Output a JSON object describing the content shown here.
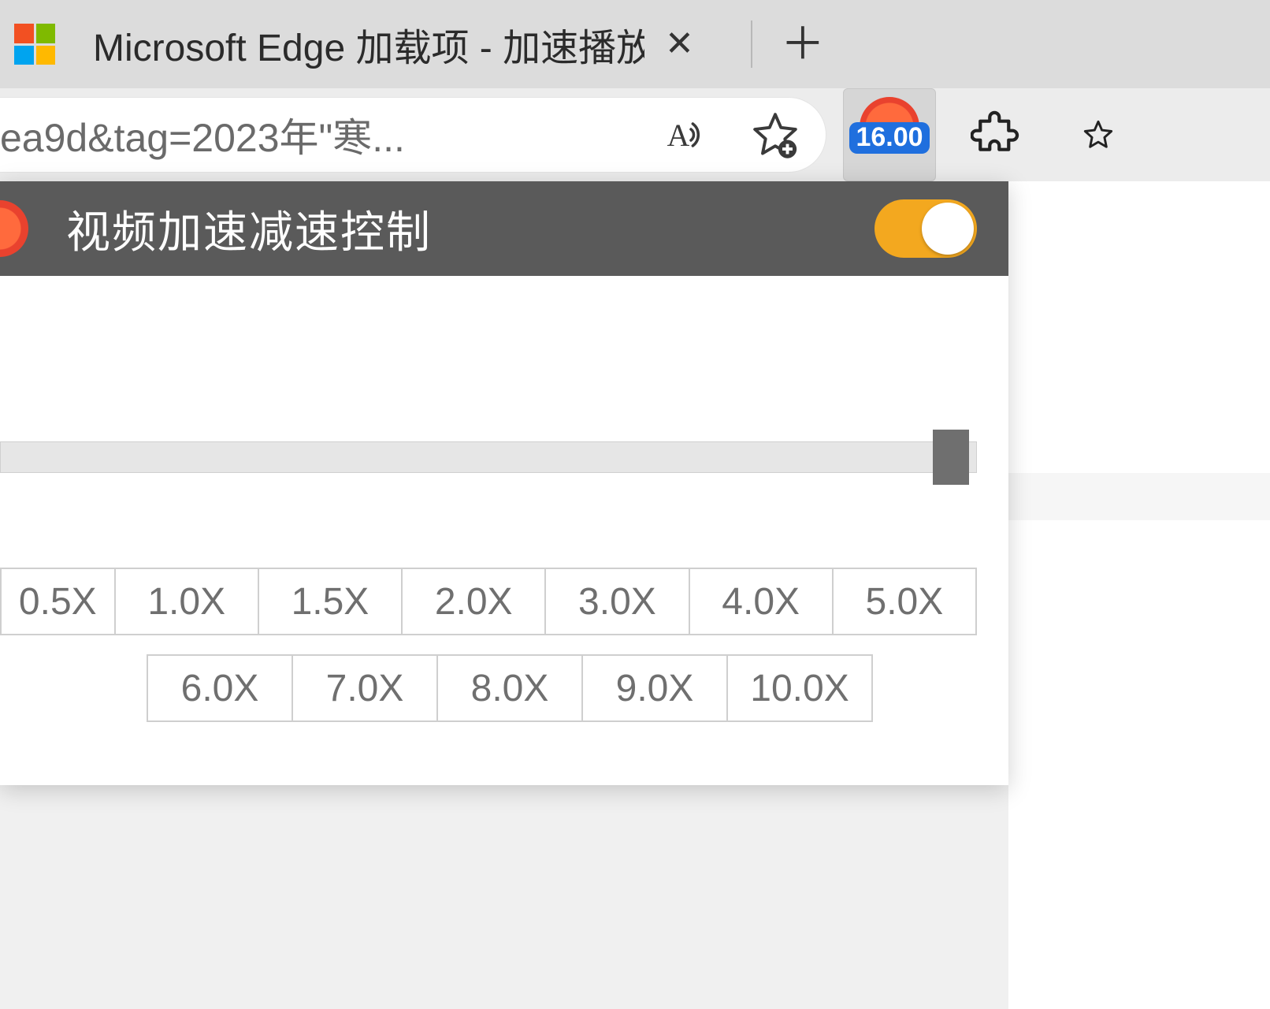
{
  "tab": {
    "title": "Microsoft Edge 加载项 - 加速播放"
  },
  "address": {
    "text": "ea9d&tag=2023年\"寒..."
  },
  "extension_badge": "16.00",
  "popup": {
    "title": "视频加速减速控制",
    "enabled": true,
    "speed_presets_row1": [
      "0.5X",
      "1.0X",
      "1.5X",
      "2.0X",
      "3.0X",
      "4.0X",
      "5.0X"
    ],
    "speed_presets_row2": [
      "6.0X",
      "7.0X",
      "8.0X",
      "9.0X",
      "10.0X"
    ]
  }
}
